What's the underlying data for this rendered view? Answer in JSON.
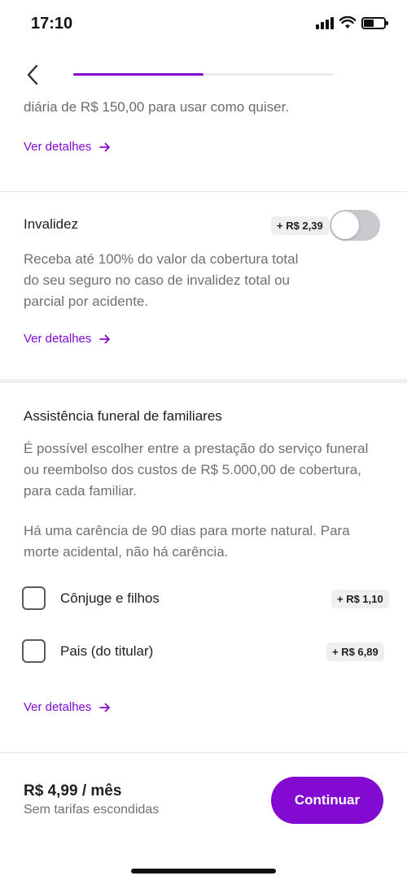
{
  "status_bar": {
    "time": "17:10",
    "battery_level": 0.5
  },
  "nav": {
    "progress": 0.5,
    "accent_color": "#820ad1",
    "back_icon": "chevron-left-icon"
  },
  "top_section": {
    "clipped_text": "diária de R$ 150,00 para usar como quiser.",
    "link": "Ver detalhes"
  },
  "invalidez": {
    "title": "Invalidez",
    "price": "+ R$ 2,39",
    "toggle_on": false,
    "description_lines": [
      "Receba até 100% do valor da cobertura total",
      "do seu seguro no caso de invalidez total ou",
      "parcial por acidente."
    ],
    "link": "Ver detalhes"
  },
  "funeral": {
    "title": "Assistência funeral de familiares",
    "description_lines": [
      "É possível escolher entre a prestação do serviço funeral",
      "ou reembolso dos custos de R$ 5.000,00 de cobertura,",
      "para cada familiar."
    ],
    "note_lines": [
      "Há uma carência de 90 dias para morte natural. Para",
      "morte acidental, não há carência."
    ],
    "options": [
      {
        "label": "Cônjuge e filhos",
        "price": "+ R$ 1,10",
        "checked": false
      },
      {
        "label": "Pais (do titular)",
        "price": "+ R$ 6,89",
        "checked": false
      }
    ],
    "link": "Ver detalhes"
  },
  "footer": {
    "price": "R$ 4,99 / mês",
    "note": "Sem tarifas escondidas",
    "button": "Continuar"
  }
}
